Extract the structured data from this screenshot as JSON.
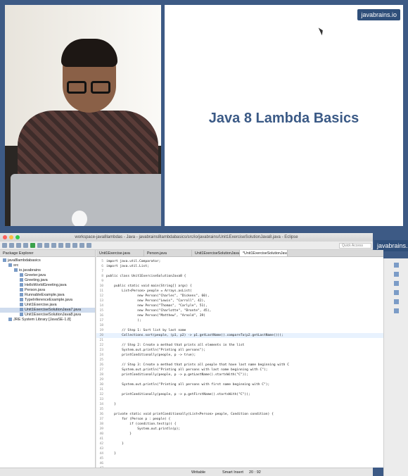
{
  "slide": {
    "brand": "javabrains.io",
    "title": "Java 8 Lambda Basics"
  },
  "eclipse": {
    "brand": "javabrains.io",
    "window_title": "workspace-java8lambdas - Java - javabrains8lambdabasics/src/io/javabrains/Unit1ExerciseSolutionJava8.java - Eclipse",
    "quick_access": "Quick Access",
    "explorer_title": "Package Explorer",
    "tree": [
      {
        "label": "java8lambdabasics",
        "indent": 0
      },
      {
        "label": "src",
        "indent": 1
      },
      {
        "label": "io.javabrains",
        "indent": 2
      },
      {
        "label": "Greeter.java",
        "indent": 3
      },
      {
        "label": "Greeting.java",
        "indent": 3
      },
      {
        "label": "HelloWorldGreeting.java",
        "indent": 3
      },
      {
        "label": "Person.java",
        "indent": 3
      },
      {
        "label": "RunnableExample.java",
        "indent": 3
      },
      {
        "label": "TypeInferenceExample.java",
        "indent": 3
      },
      {
        "label": "Unit1Exercise.java",
        "indent": 3
      },
      {
        "label": "Unit1ExerciseSolutionJava7.java",
        "indent": 3
      },
      {
        "label": "Unit1ExerciseSolutionJava8.java",
        "indent": 3
      },
      {
        "label": "JRE System Library [JavaSE-1.8]",
        "indent": 1
      }
    ],
    "tabs": [
      "Unit1Exercise.java",
      "Person.java",
      "Unit1ExerciseSolutionJava7.java",
      "*Unit1ExerciseSolutionJava8.java"
    ],
    "code": [
      {
        "n": "5",
        "t": "import java.util.Comparator;"
      },
      {
        "n": "6",
        "t": "import java.util.List;"
      },
      {
        "n": "7",
        "t": ""
      },
      {
        "n": "8",
        "t": "public class Unit1ExerciseSolutionJava8 {"
      },
      {
        "n": "9",
        "t": ""
      },
      {
        "n": "10",
        "t": "    public static void main(String[] args) {"
      },
      {
        "n": "11",
        "t": "        List<Person> people = Arrays.asList("
      },
      {
        "n": "12",
        "t": "                new Person(\"Charles\", \"Dickens\", 60),"
      },
      {
        "n": "13",
        "t": "                new Person(\"Lewis\", \"Carroll\", 42),"
      },
      {
        "n": "14",
        "t": "                new Person(\"Thomas\", \"Carlyle\", 51),"
      },
      {
        "n": "15",
        "t": "                new Person(\"Charlotte\", \"Bronte\", 45),"
      },
      {
        "n": "16",
        "t": "                new Person(\"Matthew\", \"Arnold\", 39)"
      },
      {
        "n": "17",
        "t": "                );"
      },
      {
        "n": "18",
        "t": ""
      },
      {
        "n": "19",
        "t": "        // Step 1: Sort list by last name"
      },
      {
        "n": "20",
        "t": "        Collections.sort(people, (p1, p2) -> p1.getLastName().compareTo(p2.getLastName()));"
      },
      {
        "n": "21",
        "t": ""
      },
      {
        "n": "22",
        "t": "        // Step 2: Create a method that prints all elements in the list"
      },
      {
        "n": "23",
        "t": "        System.out.println(\"Printing all persons\");"
      },
      {
        "n": "24",
        "t": "        printConditionally(people, p -> true);"
      },
      {
        "n": "25",
        "t": ""
      },
      {
        "n": "26",
        "t": "        // Step 3: Create a method that prints all people that have last name beginning with C"
      },
      {
        "n": "27",
        "t": "        System.out.println(\"Printing all persons with last name beginning with C\");"
      },
      {
        "n": "28",
        "t": "        printConditionally(people, p -> p.getLastName().startsWith(\"C\"));"
      },
      {
        "n": "29",
        "t": ""
      },
      {
        "n": "30",
        "t": "        System.out.println(\"Printing all persons with first name beginning with C\");"
      },
      {
        "n": "31",
        "t": ""
      },
      {
        "n": "32",
        "t": "        printConditionally(people, p -> p.getFirstName().startsWith(\"C\"));"
      },
      {
        "n": "33",
        "t": ""
      },
      {
        "n": "34",
        "t": "    }"
      },
      {
        "n": "35",
        "t": ""
      },
      {
        "n": "36",
        "t": "    private static void printConditionally(List<Person> people, Condition condition) {"
      },
      {
        "n": "37",
        "t": "        for (Person p : people) {"
      },
      {
        "n": "38",
        "t": "            if (condition.test(p)) {"
      },
      {
        "n": "39",
        "t": "                System.out.println(p);"
      },
      {
        "n": "40",
        "t": "            }"
      },
      {
        "n": "41",
        "t": ""
      },
      {
        "n": "42",
        "t": "        }"
      },
      {
        "n": "43",
        "t": ""
      },
      {
        "n": "44",
        "t": "    }"
      },
      {
        "n": "45",
        "t": ""
      },
      {
        "n": "46",
        "t": ""
      },
      {
        "n": "47",
        "t": ""
      }
    ],
    "status": {
      "writable": "Writable",
      "insert": "Smart Insert",
      "position": "20 : 92"
    }
  }
}
